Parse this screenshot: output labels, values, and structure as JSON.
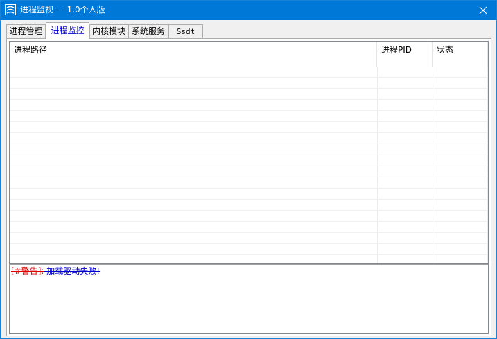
{
  "window": {
    "title": "进程监视  -  1.0个人版",
    "close_symbol": "✕"
  },
  "tabs": [
    {
      "label": "进程管理",
      "active": false
    },
    {
      "label": "进程监控",
      "active": true
    },
    {
      "label": "内核模块",
      "active": false
    },
    {
      "label": "系统服务",
      "active": false
    },
    {
      "label": "Ssdt",
      "active": false
    }
  ],
  "process_list": {
    "columns": [
      "进程路径",
      "进程PID",
      "状态"
    ],
    "rows": []
  },
  "log": {
    "tag": "[#警告]:",
    "message": " 加载驱动失败!"
  },
  "colors": {
    "titlebar": "#0078d7",
    "active_tab_text": "#0000cc",
    "log_tag": "#e00000",
    "log_message": "#0000cc"
  },
  "icons": {
    "app": "app-logo-icon",
    "close": "close-icon"
  }
}
